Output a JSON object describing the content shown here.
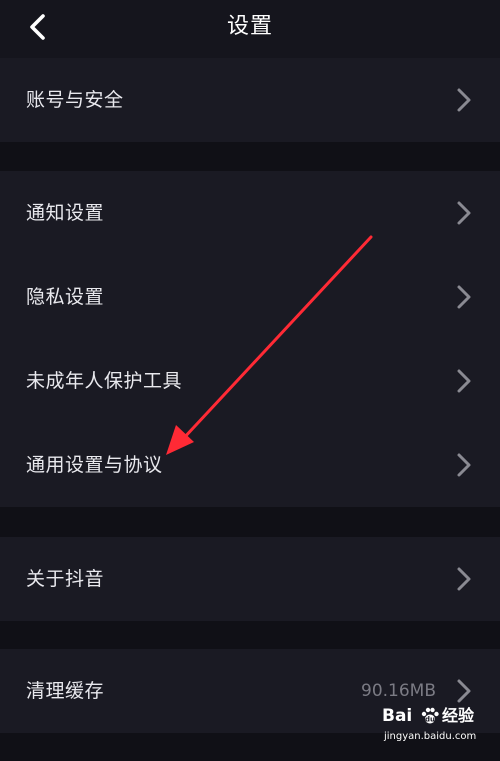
{
  "header": {
    "title": "设置"
  },
  "groups": [
    {
      "items": [
        {
          "label": "账号与安全"
        }
      ]
    },
    {
      "items": [
        {
          "label": "通知设置"
        },
        {
          "label": "隐私设置"
        },
        {
          "label": "未成年人保护工具"
        },
        {
          "label": "通用设置与协议"
        }
      ]
    },
    {
      "items": [
        {
          "label": "关于抖音"
        }
      ]
    },
    {
      "items": [
        {
          "label": "清理缓存",
          "value": "90.16MB"
        }
      ]
    }
  ],
  "annotation": {
    "color": "#ff2a35",
    "points_to": "通用设置与协议"
  },
  "watermark": {
    "brand": "Bai",
    "product": "经验",
    "url": "jingyan.baidu.com"
  },
  "colors": {
    "background": "#101016",
    "row_background": "#1a1a23",
    "text": "#e9e9ee",
    "secondary_text": "#7b7b84",
    "chevron": "#8a8a92"
  },
  "icons": {
    "back": "chevron-left-icon",
    "row_chevron": "chevron-right-icon",
    "annotation": "red-arrow-icon",
    "watermark_logo": "baidu-paw-icon"
  }
}
